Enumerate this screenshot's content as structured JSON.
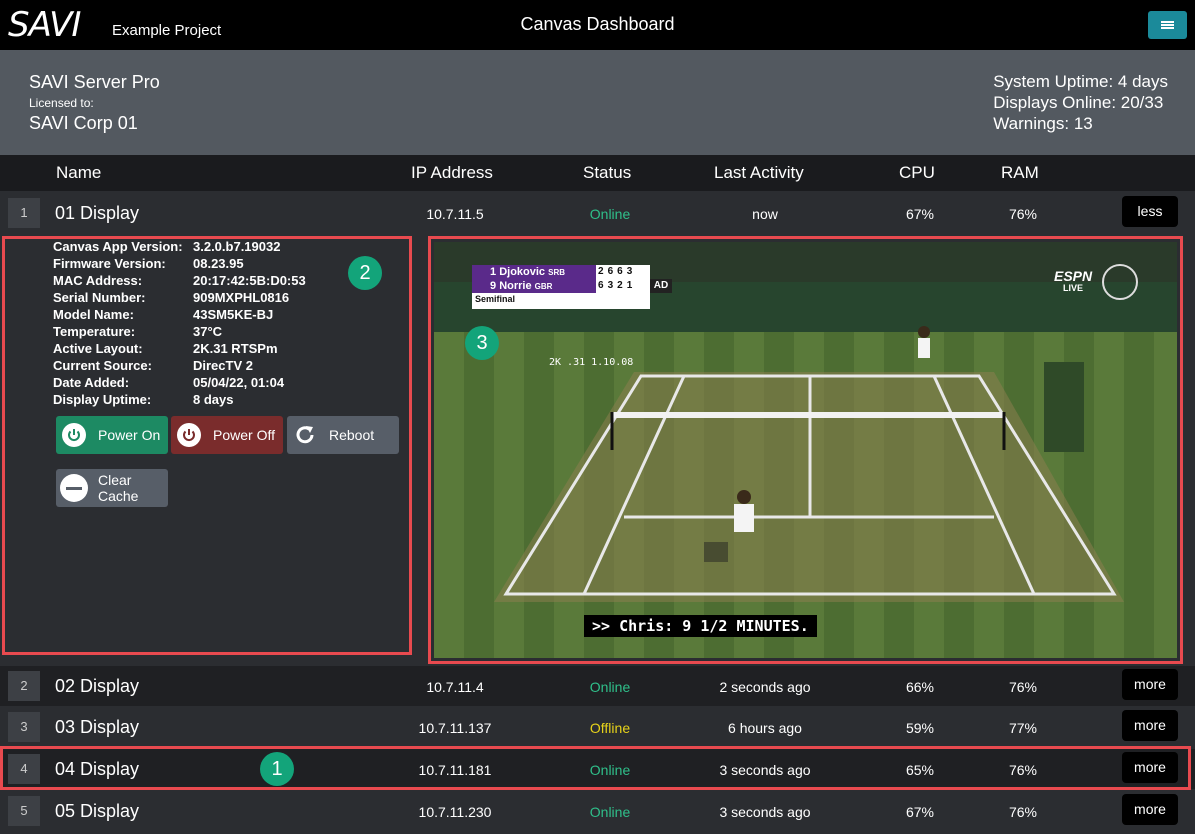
{
  "app": {
    "logo": "SAVI",
    "project": "Example Project",
    "title": "Canvas Dashboard"
  },
  "summary": {
    "server": "SAVI Server Pro",
    "licensed_label": "Licensed to:",
    "licensee": "SAVI Corp 01",
    "uptime": "System Uptime: 4 days",
    "displays_online": "Displays Online: 20/33",
    "warnings": "Warnings: 13"
  },
  "columns": [
    "Name",
    "IP Address",
    "Status",
    "Last Activity",
    "CPU",
    "RAM"
  ],
  "rows": [
    {
      "index": "1",
      "name": "01 Display",
      "ip": "10.7.11.5",
      "status": "Online",
      "activity": "now",
      "cpu": "67%",
      "ram": "76%",
      "button": "less"
    },
    {
      "index": "2",
      "name": "02 Display",
      "ip": "10.7.11.4",
      "status": "Online",
      "activity": "2 seconds ago",
      "cpu": "66%",
      "ram": "76%",
      "button": "more"
    },
    {
      "index": "3",
      "name": "03 Display",
      "ip": "10.7.11.137",
      "status": "Offline",
      "activity": "6 hours ago",
      "cpu": "59%",
      "ram": "77%",
      "button": "more"
    },
    {
      "index": "4",
      "name": "04 Display",
      "ip": "10.7.11.181",
      "status": "Online",
      "activity": "3 seconds ago",
      "cpu": "65%",
      "ram": "76%",
      "button": "more"
    },
    {
      "index": "5",
      "name": "05 Display",
      "ip": "10.7.11.230",
      "status": "Online",
      "activity": "3 seconds ago",
      "cpu": "67%",
      "ram": "76%",
      "button": "more"
    }
  ],
  "details": [
    {
      "k": "Canvas App Version:",
      "v": "3.2.0.b7.19032"
    },
    {
      "k": "Firmware Version:",
      "v": "08.23.95"
    },
    {
      "k": "MAC Address:",
      "v": "20:17:42:5B:D0:53"
    },
    {
      "k": "Serial Number:",
      "v": "909MXPHL0816"
    },
    {
      "k": "Model Name:",
      "v": "43SM5KE-BJ"
    },
    {
      "k": "Temperature:",
      "v": "37°C"
    },
    {
      "k": "Active Layout:",
      "v": "2K.31 RTSPm"
    },
    {
      "k": "Current Source:",
      "v": "DirecTV 2"
    },
    {
      "k": "Date Added:",
      "v": "05/04/22, 01:04"
    },
    {
      "k": "Display Uptime:",
      "v": "8 days"
    }
  ],
  "actions": {
    "power_on": "Power On",
    "power_off": "Power Off",
    "reboot": "Reboot",
    "clear_cache_1": "Clear",
    "clear_cache_2": "Cache"
  },
  "callouts": {
    "one": "1",
    "two": "2",
    "three": "3"
  },
  "video": {
    "player1": "Djokovic",
    "player1_seed": "1",
    "player1_country": "SRB",
    "player1_scores": [
      "2",
      "6",
      "6",
      "3"
    ],
    "player2": "Norrie",
    "player2_seed": "9",
    "player2_country": "GBR",
    "player2_scores": [
      "6",
      "3",
      "2",
      "1"
    ],
    "point": "AD",
    "round": "Semifinal",
    "network": "ESPN",
    "network_sub": "LIVE",
    "overlay": "2K .31 1.10.08",
    "caption": ">> Chris: 9 1/2 MINUTES."
  },
  "colors": {
    "online": "#2fbf8a",
    "offline": "#e6d21a",
    "accent": "#1b8a9a",
    "highlight": "#e84a4f",
    "badge": "#13a47a"
  }
}
